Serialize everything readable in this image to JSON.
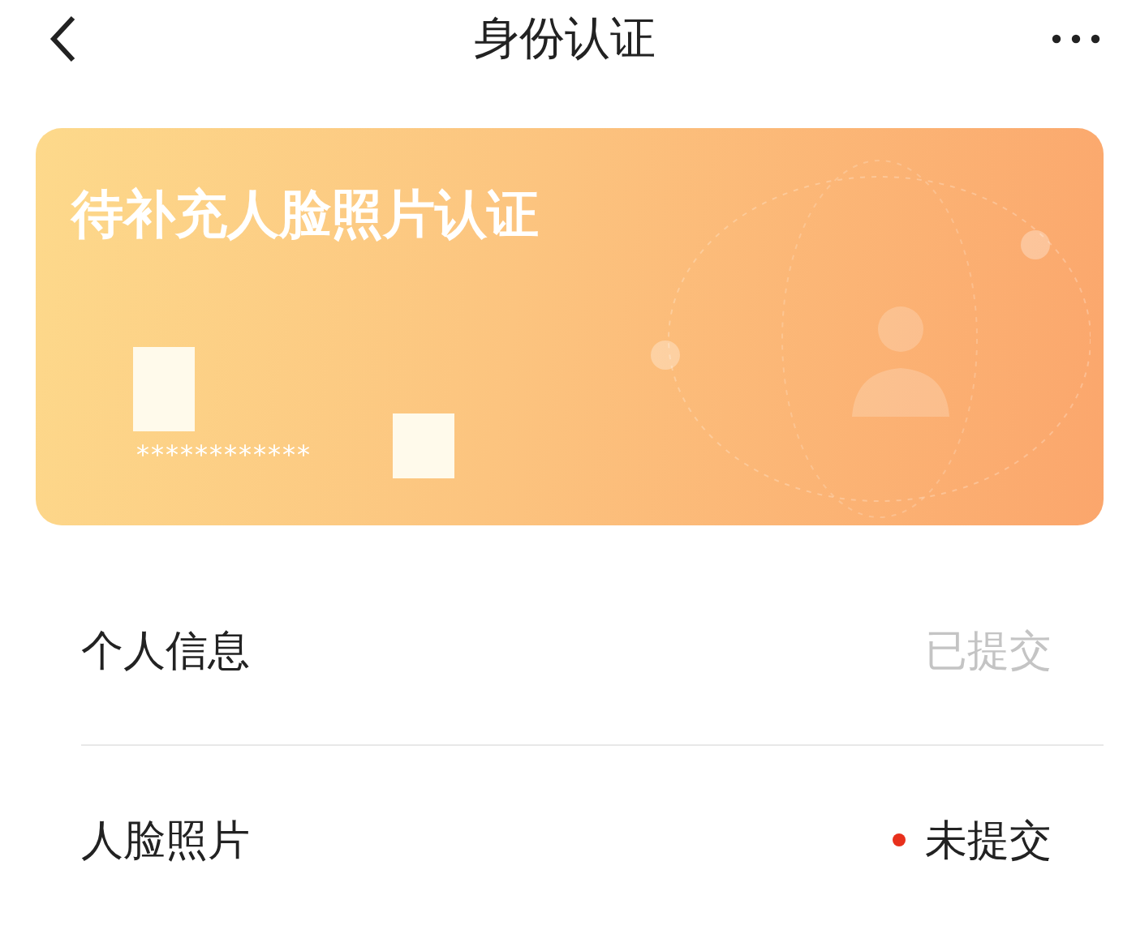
{
  "header": {
    "title": "身份认证"
  },
  "card": {
    "title": "待补充人脸照片认证",
    "masked_id": "************"
  },
  "items": [
    {
      "label": "个人信息",
      "status": "已提交",
      "submitted": true
    },
    {
      "label": "人脸照片",
      "status": "未提交",
      "submitted": false
    }
  ]
}
